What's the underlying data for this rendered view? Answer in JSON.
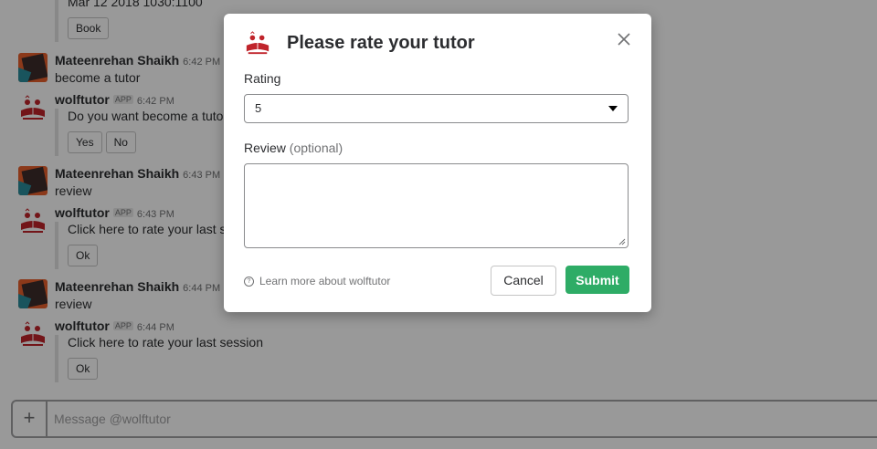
{
  "chat": {
    "top_attachment": {
      "text": "Mar 12 2018 1030:1100",
      "button": "Book"
    },
    "messages": [
      {
        "sender": "Mateenrehan Shaikh",
        "time": "6:42 PM",
        "text": "become a tutor"
      },
      {
        "sender": "wolftutor",
        "badge": "APP",
        "time": "6:42 PM",
        "attachment_text": "Do you want become a tutor?",
        "buttons": [
          "Yes",
          "No"
        ]
      },
      {
        "sender": "Mateenrehan Shaikh",
        "time": "6:43 PM",
        "text": "review"
      },
      {
        "sender": "wolftutor",
        "badge": "APP",
        "time": "6:43 PM",
        "attachment_text": "Click here to rate your last session",
        "buttons": [
          "Ok"
        ]
      },
      {
        "sender": "Mateenrehan Shaikh",
        "time": "6:44 PM",
        "text": "review"
      },
      {
        "sender": "wolftutor",
        "badge": "APP",
        "time": "6:44 PM",
        "attachment_text": "Click here to rate your last session",
        "buttons": [
          "Ok"
        ]
      }
    ]
  },
  "composer": {
    "placeholder": "Message @wolftutor",
    "plus": "+"
  },
  "modal": {
    "title": "Please rate your tutor",
    "rating_label": "Rating",
    "rating_value": "5",
    "review_label": "Review",
    "review_optional": "(optional)",
    "review_value": "",
    "learn_more": "Learn more about wolftutor",
    "cancel": "Cancel",
    "submit": "Submit"
  },
  "colors": {
    "submit_bg": "#2eac66",
    "overlay": "rgba(0,0,0,0.4)"
  }
}
